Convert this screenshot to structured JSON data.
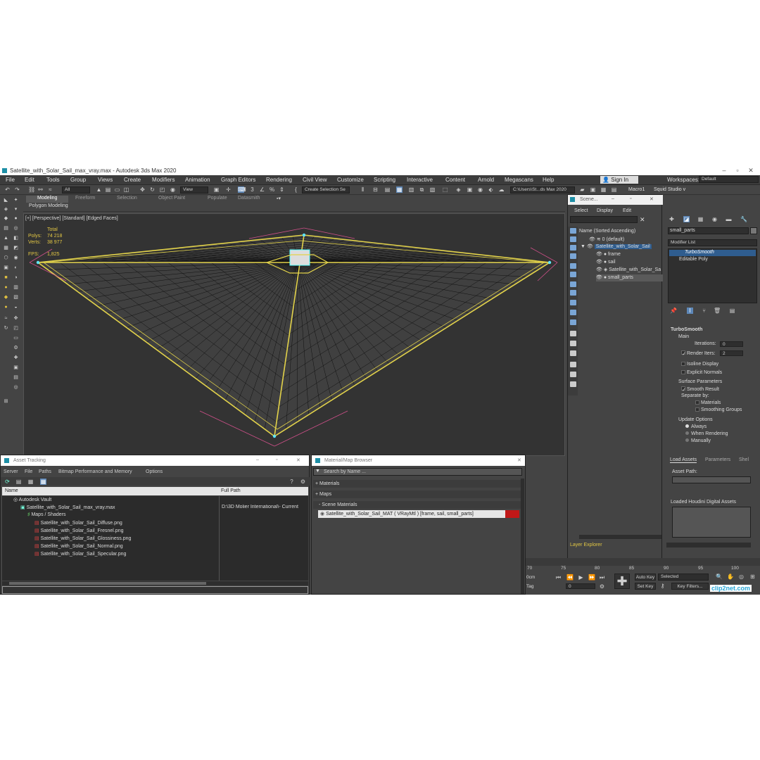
{
  "title": "Satellite_with_Solar_Sail_max_vray.max - Autodesk 3ds Max 2020",
  "menu": [
    "File",
    "Edit",
    "Tools",
    "Group",
    "Views",
    "Create",
    "Modifiers",
    "Animation",
    "Graph Editors",
    "Rendering",
    "Civil View",
    "Customize",
    "Scripting",
    "Interactive",
    "Content",
    "Arnold",
    "Megascans",
    "Help"
  ],
  "sign_in": "Sign In",
  "workspaces_label": "Workspaces:",
  "workspace": "Default",
  "toolbar": {
    "filter": "All",
    "view": "View",
    "create_selection": "Create Selection Se",
    "path": "C:\\Users\\St...ds Max 2020",
    "macro": "Macro1",
    "squid": "Squid Studio v"
  },
  "ribbon_tabs": [
    "Modeling",
    "Freeform",
    "Selection",
    "Object Paint",
    "Populate",
    "Datasmith"
  ],
  "ribbon_sub": "Polygon Modeling",
  "viewport": {
    "label": "[+] [Perspective] [Standard] [Edged Faces]",
    "total_label": "Total",
    "polys_label": "Polys:",
    "polys_value": "74 218",
    "verts_label": "Verts:",
    "verts_value": "38 977",
    "fps_label": "FPS:",
    "fps_value": "1,825"
  },
  "scene_explorer": {
    "title": "Scene...",
    "menu": [
      "Select",
      "Display",
      "Edit"
    ],
    "column": "Name (Sorted Ascending)",
    "items": [
      "0 (default)",
      "Satellite_with_Solar_Sail",
      "frame",
      "sail",
      "Satellite_with_Solar_Sa",
      "small_parts"
    ],
    "footer": "Layer Explorer"
  },
  "command_panel": {
    "object_name": "small_parts",
    "modifier_list": "Modifier List",
    "stack": [
      "TurboSmooth",
      "Editable Poly"
    ],
    "rollout": "TurboSmooth",
    "main": "Main",
    "iterations_label": "Iterations:",
    "iterations": "0",
    "render_iters_label": "Render Iters:",
    "render_iters": "2",
    "isoline": "Isoline Display",
    "explicit": "Explicit Normals",
    "surface": "Surface Parameters",
    "smooth_result": "Smooth Result",
    "separate_by": "Separate by:",
    "materials": "Materials",
    "smoothing_groups": "Smoothing Groups",
    "update_options": "Update Options",
    "always": "Always",
    "when_rendering": "When Rendering",
    "manually": "Manually"
  },
  "assets_panel": {
    "tabs": [
      "Load Assets",
      "Parameters",
      "Shel"
    ],
    "asset_path": "Asset Path:",
    "houdini": "Loaded Houdini Digital Assets"
  },
  "asset_tracking": {
    "title": "Asset Tracking",
    "menu": [
      "Server",
      "File",
      "Paths",
      "Bitmap Performance and Memory",
      "Options"
    ],
    "columns": [
      "Name",
      "Full Path"
    ],
    "rows": [
      {
        "name": "Autodesk Vault",
        "path": ""
      },
      {
        "name": "Satellite_with_Solar_Sail_max_vray.max",
        "path": "D:\\3D Molier International\\- Current"
      },
      {
        "name": "Maps / Shaders",
        "path": ""
      },
      {
        "name": "Satellite_with_Solar_Sail_Diffuse.png",
        "path": ""
      },
      {
        "name": "Satellite_with_Solar_Sail_Fresnel.png",
        "path": ""
      },
      {
        "name": "Satellite_with_Solar_Sail_Glossiness.png",
        "path": ""
      },
      {
        "name": "Satellite_with_Solar_Sail_Normal.png",
        "path": ""
      },
      {
        "name": "Satellite_with_Solar_Sail_Specular.png",
        "path": ""
      }
    ]
  },
  "material_browser": {
    "title": "Material/Map Browser",
    "search": "Search by Name ...",
    "materials": "+ Materials",
    "maps": "+ Maps",
    "scene_materials": "- Scene Materials",
    "item": "Satellite_with_Solar_Sail_MAT  ( VRayMtl )  [frame, sail, small_parts]"
  },
  "timeline": {
    "ticks": [
      "70",
      "75",
      "80",
      "85",
      "90",
      "95",
      "100"
    ],
    "frame": "0",
    "auto_key": "Auto Key",
    "selected": "Selected",
    "set_key": "Set Key",
    "key_filters": "Key Filters...",
    "left_a": "0cm",
    "left_b": "Tag"
  },
  "watermark": "clip2net.com"
}
